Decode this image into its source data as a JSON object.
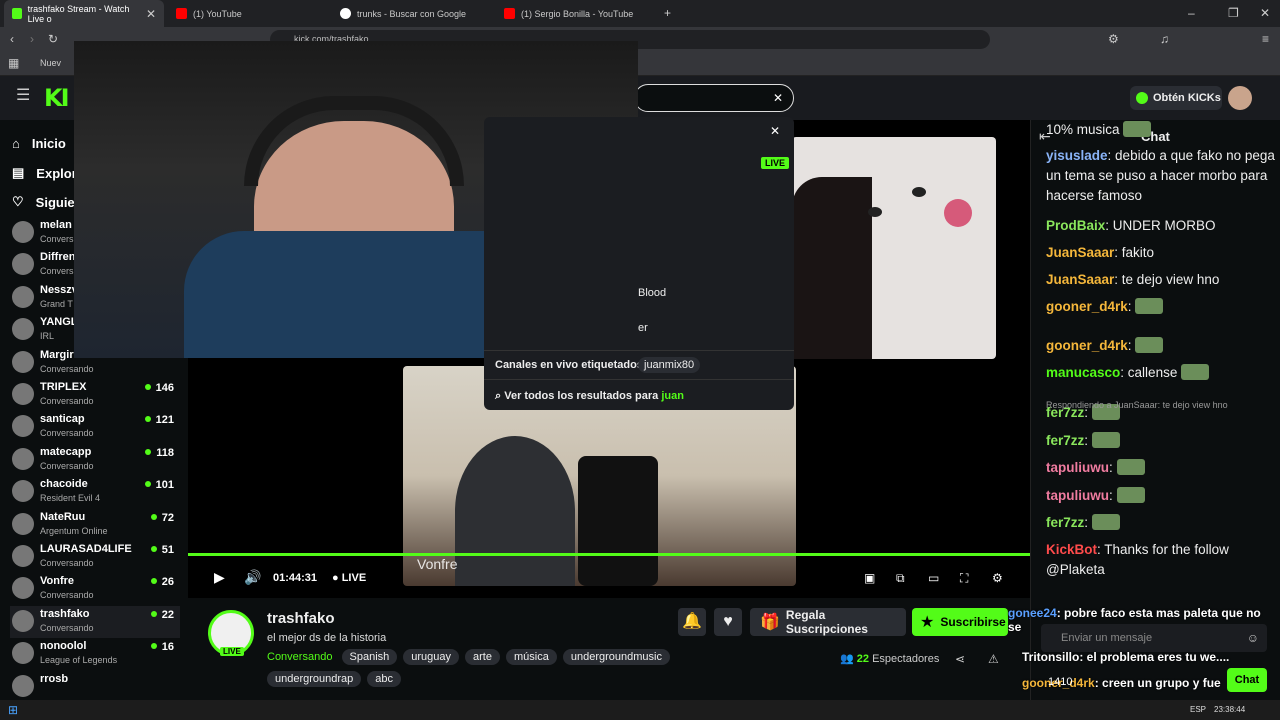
{
  "browser": {
    "tabs": [
      {
        "title": "trashfako Stream - Watch Live o",
        "active": true
      },
      {
        "title": "(1) YouTube"
      },
      {
        "title": "trunks - Buscar con Google"
      },
      {
        "title": "(1) Sergio Bonilla - YouTube"
      }
    ],
    "url": "kick.com/trashfako",
    "bookmark": "Nuev"
  },
  "nav": {
    "logo": "KI",
    "get_kicks": "Obtén KICKs",
    "items": [
      {
        "label": "Inicio"
      },
      {
        "label": "Explor"
      },
      {
        "label": "Siguie"
      }
    ]
  },
  "search": {
    "channel_label": "Blood",
    "channel_label2": "er",
    "tagged_label": "Canales en vivo etiquetados",
    "tagged_value": "juanmix80",
    "all_results_prefix": "Ver todos los resultados para",
    "query": "juan",
    "live_badge": "LIVE"
  },
  "sidebar": {
    "channels": [
      {
        "name": "melan",
        "cat": "Convers",
        "viewers": ""
      },
      {
        "name": "Diffren",
        "cat": "Convers",
        "viewers": ""
      },
      {
        "name": "Nesszv",
        "cat": "Grand T",
        "viewers": ""
      },
      {
        "name": "YANGL",
        "cat": "IRL",
        "viewers": ""
      },
      {
        "name": "Margiri",
        "cat": "Conversando",
        "viewers": ""
      },
      {
        "name": "TRIPLEX",
        "cat": "Conversando",
        "viewers": "146"
      },
      {
        "name": "santicap",
        "cat": "Conversando",
        "viewers": "121"
      },
      {
        "name": "matecapp",
        "cat": "Conversando",
        "viewers": "118"
      },
      {
        "name": "chacoide",
        "cat": "Resident Evil 4",
        "viewers": "101"
      },
      {
        "name": "NateRuu",
        "cat": "Argentum Online",
        "viewers": "72"
      },
      {
        "name": "LAURASAD4LIFE",
        "cat": "Conversando",
        "viewers": "51"
      },
      {
        "name": "Vonfre",
        "cat": "Conversando",
        "viewers": "26"
      },
      {
        "name": "trashfako",
        "cat": "Conversando",
        "viewers": "22"
      },
      {
        "name": "nonoolol",
        "cat": "League of Legends",
        "viewers": "16"
      },
      {
        "name": "rrosb",
        "cat": "",
        "viewers": ""
      }
    ]
  },
  "player": {
    "time": "01:44:31",
    "live": "LIVE",
    "guest_name": "Vonfre",
    "progress": 1.0
  },
  "stream": {
    "streamer": "trashfako",
    "title": "el mejor ds de la historia",
    "category": "Conversando",
    "live_badge": "LIVE",
    "tags": [
      "Spanish",
      "uruguay",
      "arte",
      "música",
      "undergroundmusic",
      "undergroundrap",
      "abc"
    ],
    "viewers": "22",
    "viewers_label": "Espectadores",
    "gift_label": "Regala Suscripciones",
    "sub_label": "Suscribirse"
  },
  "chat": {
    "title": "Chat",
    "messages": [
      {
        "user": "",
        "text": "10% musica",
        "color": "#eeeeee"
      },
      {
        "user": "yisuslade",
        "text": ": debido a que fako no pega un tema se puso a hacer morbo para hacerse famoso",
        "color": "#8ab4f8"
      },
      {
        "user": "ProdBaix",
        "text": ": UNDER MORBO",
        "color": "#8ae65c"
      },
      {
        "user": "JuanSaaar",
        "text": ": fakito",
        "color": "#f5b73b"
      },
      {
        "user": "JuanSaaar",
        "text": ": te dejo view hno",
        "color": "#f5b73b"
      },
      {
        "user": "gooner_d4rk",
        "text": ":",
        "color": "#f5b73b"
      },
      {
        "user": "gooner_d4rk",
        "text": ":",
        "color": "#f5b73b"
      },
      {
        "user": "manucasco",
        "text": ": callense",
        "color": "#53fc18"
      },
      {
        "user": "fer7zz",
        "text": ":",
        "color": "#8ae65c"
      },
      {
        "user": "fer7zz",
        "text": ":",
        "color": "#8ae65c"
      },
      {
        "user": "tapuliuwu",
        "text": ":",
        "color": "#f07ca0"
      },
      {
        "user": "tapuliuwu",
        "text": ":",
        "color": "#f07ca0"
      },
      {
        "user": "fer7zz",
        "text": ":",
        "color": "#8ae65c"
      },
      {
        "user": "KickBot",
        "text": ": Thanks for the follow @Plaketa",
        "color": "#ff4b4b"
      }
    ],
    "reply_note": "Respondiendo a JuanSaaar: te dejo view hno",
    "input_placeholder": "Enviar un mensaje",
    "send_label": "Chat",
    "overlay_lines": [
      {
        "user": "gonee24",
        "text": ": pobre faco esta mas paleta que no se"
      },
      {
        "user": "Tritonsillo",
        "text": ": el problema eres tu we...."
      },
      {
        "user": "gooner_d4rk",
        "text": ": creen un grupo y fue"
      },
      {
        "user": "tapuliuwu",
        "text": ":"
      }
    ],
    "overlay_count": "1410"
  },
  "taskbar": {
    "lang": "ESP",
    "time": "23:38:44"
  },
  "colors": {
    "accent": "#53fc18",
    "bg": "#0b0e0f"
  }
}
